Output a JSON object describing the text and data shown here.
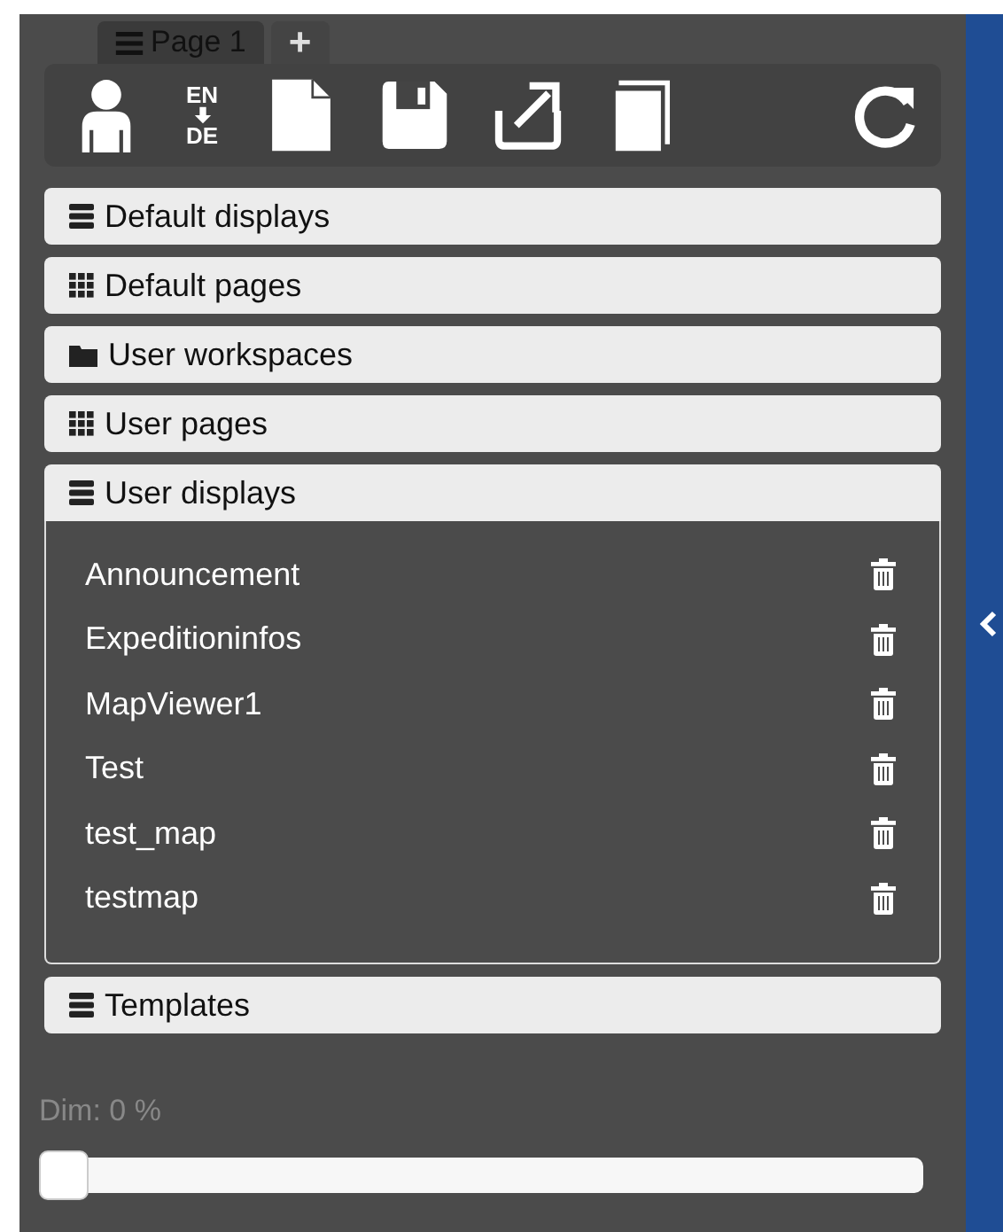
{
  "tabs": [
    {
      "label": "Page 1",
      "kind": "page",
      "selected": true
    },
    {
      "label": "+",
      "kind": "add",
      "selected": false
    }
  ],
  "toolbar": {
    "language_from": "EN",
    "language_to": "DE"
  },
  "sections": [
    {
      "label": "Default displays",
      "kind": "list",
      "expanded": false
    },
    {
      "label": "Default pages",
      "kind": "grid",
      "expanded": false
    },
    {
      "label": "User workspaces",
      "kind": "folder",
      "expanded": false
    },
    {
      "label": "User pages",
      "kind": "grid",
      "expanded": false
    },
    {
      "label": "User displays",
      "kind": "list",
      "expanded": true,
      "items": [
        "Announcement",
        "Expeditioninfos",
        "MapViewer1",
        "Test",
        "test_map",
        "testmap"
      ]
    },
    {
      "label": "Templates",
      "kind": "list",
      "expanded": false
    }
  ],
  "dim": {
    "label": "Dim: 0 %",
    "level": 0
  }
}
